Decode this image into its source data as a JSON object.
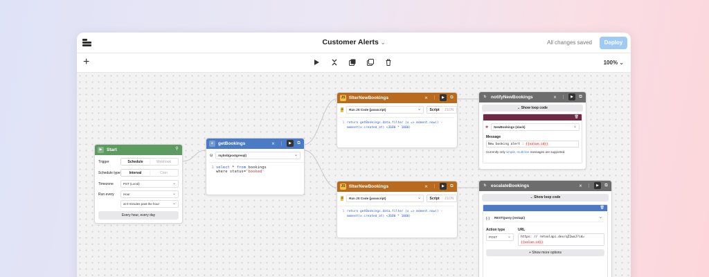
{
  "header": {
    "title": "Customer Alerts",
    "saved": "All changes saved",
    "deploy": "Deploy"
  },
  "toolbar": {
    "zoom": "100%"
  },
  "start": {
    "title": "Start",
    "trigger_label": "Trigger",
    "tab_schedule": "Schedule",
    "tab_webhook": "Webhook",
    "schedule_type_label": "Schedule type",
    "opt_interval": "Interval",
    "opt_cron": "Cron",
    "timezone_label": "Timezone",
    "timezone_value": "PST (Local)",
    "run_every_label": "Run every",
    "run_every_value": "Hour",
    "minutes_value": "at 0 minutes past the hour",
    "summary": "Every hour, every day"
  },
  "getBookings": {
    "title": "getBookings",
    "resource": "mybnb(postgresql)",
    "code": [
      {
        "ln": "1",
        "kw": "select",
        "rest": " * ",
        "kw2": "from",
        "rest2": " bookings"
      },
      {
        "ln": "",
        "plain": "where status=",
        "str": "'booked'"
      }
    ]
  },
  "filter1": {
    "title": "filterNewBookings",
    "action": "Run JS Code (javascript)",
    "script": "Script",
    "json": "JSON",
    "code": "return getBookings.data.filter (x => moment.now() - moment(x.created_at) <3600 * 1000)",
    "ln": "1"
  },
  "filter2": {
    "title": "filterNewBookings",
    "action": "Run JS Code (javascript)",
    "script": "Script",
    "json": "JSON",
    "code": "return getBookings.data.filter (x => moment.now() - moment(x.created_at) <3600 * 1000)",
    "ln": "1"
  },
  "notify": {
    "title": "notifyNewBookings",
    "loop": "Show loop code",
    "resource": "NewBookings (slack)",
    "message_label": "Message",
    "message_text": "New booking alert : ",
    "message_var": "{{value.id}}",
    "note_pre": "Currently only ",
    "note_link": "simple, multi-line",
    "note_post": " messages are supported."
  },
  "escalate": {
    "title": "escalateBookings",
    "loop": "Show loop code",
    "resource": "RESTQuery (restapi)",
    "action_label": "Action type",
    "action_value": "POST",
    "url_label": "URL",
    "url_value": "https: // retoolapi.dev/qZ2waJ?id=",
    "url_var": "{{value.id}}",
    "more": "+ Show more options"
  },
  "colors": {
    "start": "#5d9b60",
    "query": "#4a7bc4",
    "js": "#b86a1e",
    "loop": "#6d6d6d",
    "slack": "#6e2a45",
    "rest": "#4a7bc4"
  }
}
